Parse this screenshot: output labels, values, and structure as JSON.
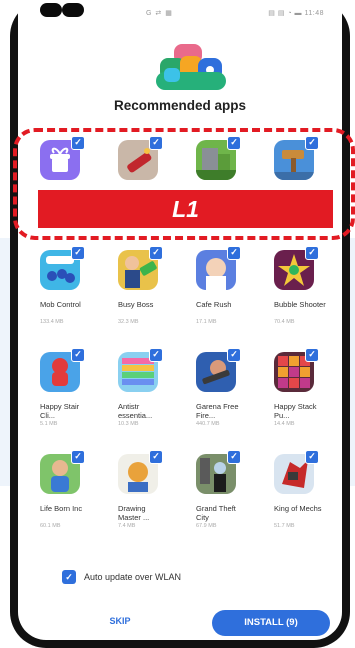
{
  "status_bar": {
    "left": "G ⇄ ▦",
    "right": "▤ ▤ ◔ ▬ 11:48"
  },
  "dialog": {
    "title": "Recommended apps"
  },
  "apps": [
    {
      "name": "",
      "size": "",
      "checked": true,
      "icon": "gift-box-app-icon"
    },
    {
      "name": "",
      "size": "",
      "checked": true,
      "icon": "dynamite-game-icon"
    },
    {
      "name": "",
      "size": "",
      "checked": true,
      "icon": "block-world-game-icon"
    },
    {
      "name": "",
      "size": "",
      "checked": true,
      "icon": "hammer-game-icon"
    },
    {
      "name": "Mob Control",
      "size": "133.4 MB",
      "checked": true,
      "icon": "mob-control-icon"
    },
    {
      "name": "Busy Boss",
      "size": "32.3 MB",
      "checked": true,
      "icon": "busy-boss-icon"
    },
    {
      "name": "Cafe Rush",
      "size": "17.1 MB",
      "checked": true,
      "icon": "cafe-rush-icon"
    },
    {
      "name": "Bubble Shooter",
      "size": "70.4 MB",
      "checked": true,
      "icon": "bubble-shooter-icon"
    },
    {
      "name": "Happy Stair Cli...",
      "size": "5.1 MB",
      "checked": true,
      "icon": "happy-stair-icon"
    },
    {
      "name": "Antistr essentia...",
      "size": "10.3 MB",
      "checked": true,
      "icon": "antistress-icon"
    },
    {
      "name": "Garena Free Fire...",
      "size": "440.7 MB",
      "checked": true,
      "icon": "free-fire-icon"
    },
    {
      "name": "Happy Stack Pu...",
      "size": "14.4 MB",
      "checked": true,
      "icon": "happy-stack-icon"
    },
    {
      "name": "Life Born Inc",
      "size": "60.1 MB",
      "checked": true,
      "icon": "life-born-icon"
    },
    {
      "name": "Drawing Master ...",
      "size": "7.4 MB",
      "checked": true,
      "icon": "drawing-master-icon"
    },
    {
      "name": "Grand Theft City",
      "size": "67.9 MB",
      "checked": true,
      "icon": "grand-theft-city-icon"
    },
    {
      "name": "King of Mechs",
      "size": "51.7 MB",
      "checked": true,
      "icon": "king-of-mechs-icon"
    }
  ],
  "auto_update": {
    "label": "Auto update over WLAN",
    "checked": true
  },
  "buttons": {
    "skip": "SKIP",
    "install": "INSTALL (9)"
  },
  "overlay": {
    "label": "L1",
    "color": "#e21b23"
  },
  "colors": {
    "accent": "#2f6fdc",
    "highlight": "#e21b23"
  }
}
